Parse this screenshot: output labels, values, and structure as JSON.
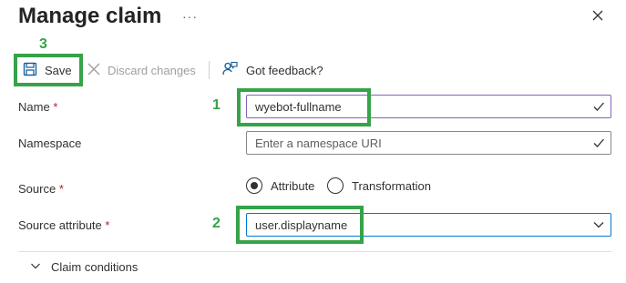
{
  "header": {
    "title": "Manage claim",
    "more_label": "···",
    "close_icon": "close-icon"
  },
  "toolbar": {
    "save_label": "Save",
    "discard_label": "Discard changes",
    "feedback_label": "Got feedback?",
    "save_icon": "save-icon",
    "discard_icon": "discard-x-icon",
    "feedback_icon": "feedback-person-icon"
  },
  "form": {
    "name": {
      "label": "Name",
      "required_mark": "*",
      "value": "wyebot-fullname"
    },
    "namespace": {
      "label": "Namespace",
      "placeholder": "Enter a namespace URI"
    },
    "source": {
      "label": "Source",
      "required_mark": "*",
      "options": [
        "Attribute",
        "Transformation"
      ],
      "selected": "Attribute"
    },
    "source_attribute": {
      "label": "Source attribute",
      "required_mark": "*",
      "value": "user.displayname"
    }
  },
  "expander": {
    "label": "Claim conditions"
  },
  "annotations": {
    "one": "1",
    "two": "2",
    "three": "3",
    "color": "#36a348"
  },
  "colors": {
    "required": "#a4262c",
    "focus_border": "#0078d4",
    "name_border": "#8764b8"
  }
}
